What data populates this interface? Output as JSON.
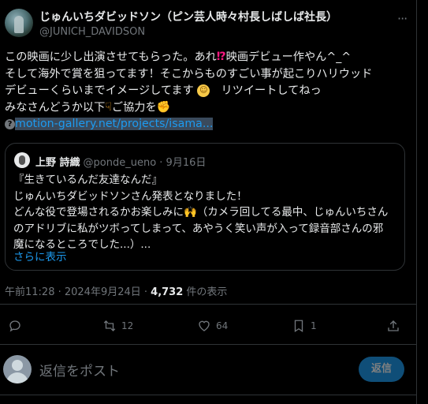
{
  "tweet": {
    "display_name": "じゅんいちダビッドソン（ピン芸人時々村長しばしば社長）",
    "handle": "@JUNICH_DAVIDSON",
    "more_glyph": "···",
    "lines": {
      "l1a": "この映画に少し出演させてもらった。あれ",
      "l1b": "映画デビュー作やん^_^",
      "l2": "そして海外で賞を狙ってます！そこからものすごい事が起こりハリウッド",
      "l3a": "デビューくらいまでイメージしてます",
      "l3b": "　リツイートしてねっ",
      "l4": "みなさんどうか以下",
      "l4b": "ご協力を"
    },
    "link_text": "motion-gallery.net/projects/isama...",
    "link_icon": "?",
    "emoji": {
      "interrobang": "⁉",
      "face": "☺",
      "point_down": "☟",
      "fist": "✊"
    }
  },
  "quote": {
    "name": "上野 詩織",
    "meta": "@ponde_ueno · 9月16日",
    "lines": [
      "『生きているんだ友達なんだ』",
      "じゅんいちダビッドソンさん発表となりました！",
      "どんな役で登場されるかお楽しみに🙌（カメラ回してる最中、じゅんいちさん",
      "のアドリブに私がツボってしまって、あやうく笑い声が入って録音部さんの邪",
      "魔になるところでした...）..."
    ],
    "show_more": "さらに表示"
  },
  "meta": {
    "timestamp": "午前11:28 · 2024年9月24日 · ",
    "views_count": "4,732",
    "views_label": " 件の表示"
  },
  "actions": {
    "retweets": "12",
    "likes": "64",
    "bookmarks": "1"
  },
  "reply": {
    "placeholder": "返信をポスト",
    "button": "返信"
  },
  "colors": {
    "accent": "#1d9bf0",
    "muted": "#71767b",
    "border": "#2f3336",
    "bg": "#000000"
  }
}
